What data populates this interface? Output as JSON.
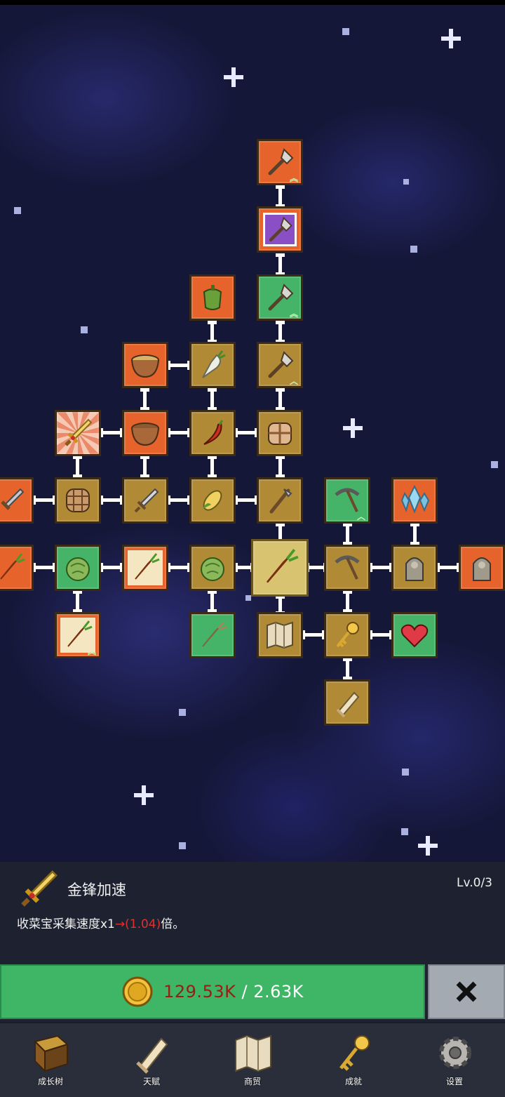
{
  "skill_tree": {
    "nodes": [
      {
        "id": "shovel-top",
        "icon": "shovel-icon",
        "color": "orange"
      },
      {
        "id": "shovel-purple",
        "icon": "shovel-icon",
        "color": "purple"
      },
      {
        "id": "shovel-green",
        "icon": "shovel-icon",
        "color": "green"
      },
      {
        "id": "pepper",
        "icon": "bell-pepper-icon",
        "color": "orange"
      },
      {
        "id": "bowl-top",
        "icon": "bowl-icon",
        "color": "orange"
      },
      {
        "id": "radish",
        "icon": "radish-icon",
        "color": "brown"
      },
      {
        "id": "shovel-brown",
        "icon": "shovel-icon",
        "color": "brown"
      },
      {
        "id": "golden-sword",
        "icon": "golden-sword-icon",
        "color": "selected"
      },
      {
        "id": "bowl-mid",
        "icon": "bowl-icon",
        "color": "orange"
      },
      {
        "id": "chili",
        "icon": "chili-icon",
        "color": "brown"
      },
      {
        "id": "backpack",
        "icon": "backpack-icon",
        "color": "brown"
      },
      {
        "id": "sword-left",
        "icon": "sword-icon",
        "color": "orange"
      },
      {
        "id": "barrel",
        "icon": "barrel-icon",
        "color": "brown"
      },
      {
        "id": "dagger",
        "icon": "dagger-icon",
        "color": "brown"
      },
      {
        "id": "corn",
        "icon": "corn-icon",
        "color": "brown"
      },
      {
        "id": "hoe",
        "icon": "hoe-icon",
        "color": "brown"
      },
      {
        "id": "pickaxe-green",
        "icon": "pickaxe-icon",
        "color": "green"
      },
      {
        "id": "crystal",
        "icon": "crystal-icon",
        "color": "orange"
      },
      {
        "id": "carrot-left",
        "icon": "carrot-icon",
        "color": "orange"
      },
      {
        "id": "cabbage-green",
        "icon": "cabbage-icon",
        "color": "green"
      },
      {
        "id": "carrot-mid",
        "icon": "carrot-icon",
        "color": "orange"
      },
      {
        "id": "cabbage-brown",
        "icon": "cabbage-icon",
        "color": "brown"
      },
      {
        "id": "carrot-center",
        "icon": "carrot-icon",
        "color": "root"
      },
      {
        "id": "pickaxe-brown",
        "icon": "pickaxe-icon",
        "color": "brown"
      },
      {
        "id": "statue-brown",
        "icon": "statue-icon",
        "color": "brown"
      },
      {
        "id": "statue-orange",
        "icon": "statue-icon",
        "color": "orange"
      },
      {
        "id": "carrot-bottom",
        "icon": "carrot-icon",
        "color": "orange"
      },
      {
        "id": "parsnip",
        "icon": "parsnip-icon",
        "color": "green"
      },
      {
        "id": "map",
        "icon": "map-icon",
        "color": "brown"
      },
      {
        "id": "key",
        "icon": "key-icon",
        "color": "brown"
      },
      {
        "id": "heart",
        "icon": "heart-icon",
        "color": "green"
      },
      {
        "id": "scroll",
        "icon": "scroll-icon",
        "color": "brown"
      }
    ]
  },
  "info": {
    "name": "金锋加速",
    "level": "Lv.0/3",
    "desc_prefix": "收菜宝采集速度x1",
    "desc_arrow": "→",
    "desc_value": "(1.04)",
    "desc_suffix": "倍。",
    "icon": "golden-sword-icon"
  },
  "upgrade": {
    "current": "129.53K",
    "separator": " / ",
    "cost": "2.63K",
    "coin_icon": "gold-coin-icon"
  },
  "close": {
    "icon": "close-x-icon"
  },
  "nav": [
    {
      "label": "成长树",
      "icon": "book-icon"
    },
    {
      "label": "天赋",
      "icon": "scroll-icon"
    },
    {
      "label": "商贸",
      "icon": "map-icon"
    },
    {
      "label": "成就",
      "icon": "key-icon"
    },
    {
      "label": "设置",
      "icon": "gear-icon"
    }
  ],
  "colors": {
    "node_brown": "#b08a35",
    "node_orange": "#e6642b",
    "node_green": "#46b468",
    "button_green": "#3fb566",
    "cost_red": "#9a1c12",
    "desc_red": "#e03030",
    "panel": "#1e2230"
  }
}
